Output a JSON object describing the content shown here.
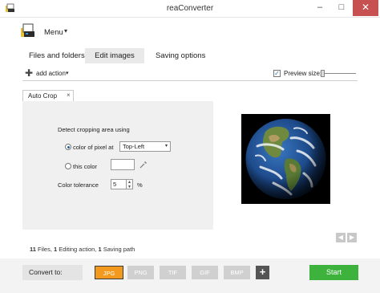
{
  "window": {
    "title": "reaConverter",
    "minimize_glyph": "–",
    "maximize_glyph": "□",
    "close_glyph": "✕"
  },
  "menu": {
    "label": "Menu",
    "caret": "▾"
  },
  "main_tabs": [
    {
      "label": "Files and folders",
      "active": false
    },
    {
      "label": "Edit images",
      "active": true
    },
    {
      "label": "Saving options",
      "active": false
    }
  ],
  "toolbar": {
    "add_action_label": "add action",
    "add_action_caret": "▾",
    "preview_checked_glyph": "✓",
    "preview_size_label": "Preview size:",
    "preview_checked": true
  },
  "action_tab": {
    "label": "Auto Crop",
    "close_glyph": "×"
  },
  "auto_crop": {
    "detect_label": "Detect cropping area using",
    "option_pixel_label": "color of pixel at",
    "option_this_color_label": "this color",
    "selected_option": "color of pixel at",
    "pixel_position": "Top-Left",
    "select_caret": "▾",
    "tolerance_label": "Color tolerance",
    "tolerance_value": "5",
    "tolerance_unit": "%",
    "spin_up": "▲",
    "spin_down": "▼"
  },
  "navigation": {
    "prev_glyph": "◀",
    "next_glyph": "▶"
  },
  "summary": {
    "files_count": "11",
    "files_text": " Files, ",
    "editing_count": "1",
    "editing_text": " Editing action, ",
    "saving_count": "1",
    "saving_text": " Saving path"
  },
  "bottom": {
    "convert_to_label": "Convert to:",
    "formats": [
      "JPG",
      "PNG",
      "TIF",
      "GIF",
      "BMP"
    ],
    "selected_format": "JPG",
    "add_format_glyph": "+",
    "start_label": "Start"
  },
  "colors": {
    "accent_orange": "#f39a1e",
    "start_green": "#3db33d",
    "close_red": "#c75050"
  },
  "icons": {
    "app_icon": "app-logo-icon",
    "add_action": "plus-icon",
    "color_picker": "eyedropper-icon",
    "preview_image": "earth-globe-image"
  }
}
